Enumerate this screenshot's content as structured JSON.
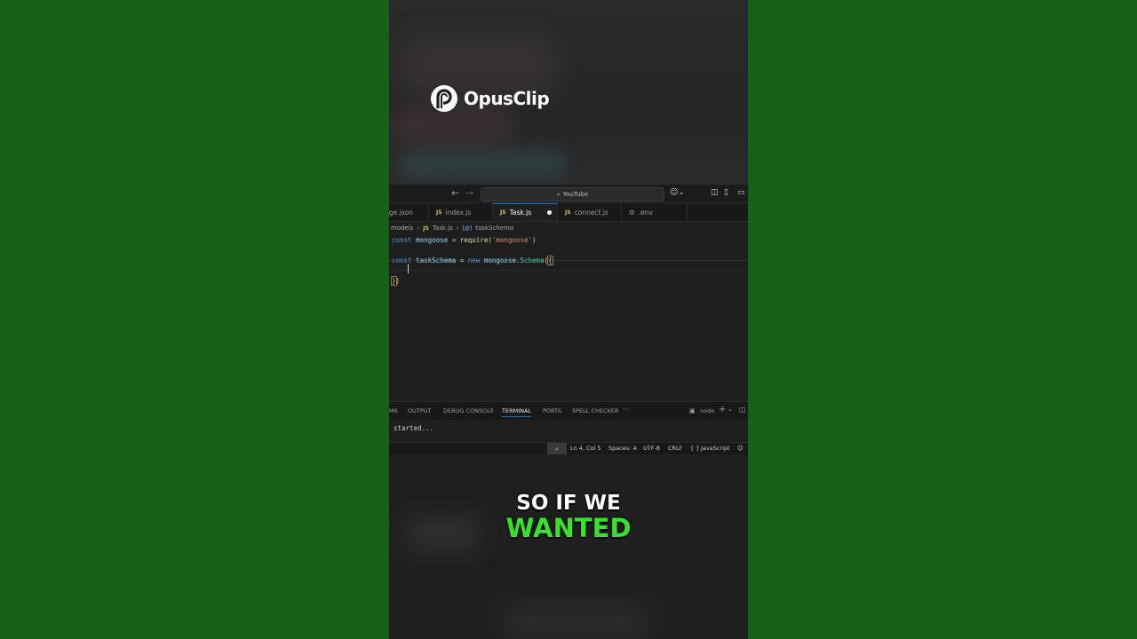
{
  "brand": {
    "name": "OpusClip"
  },
  "titlebar": {
    "search_text": "YouTube"
  },
  "tabs": [
    {
      "label": "ge.json",
      "icon": "json-icon"
    },
    {
      "label": "index.js",
      "icon": "JS"
    },
    {
      "label": "Task.js",
      "icon": "JS",
      "active": true,
      "modified": true
    },
    {
      "label": "connect.js",
      "icon": "JS"
    },
    {
      "label": ".env",
      "icon": "gear-icon"
    }
  ],
  "breadcrumb": {
    "folder": "models",
    "file_icon": "JS",
    "file": "Task.js",
    "symbol_icon": "[@]",
    "symbol": "taskSchema"
  },
  "code": {
    "line1": {
      "kw": "const",
      "var": "mongoose",
      "op": " = ",
      "fn": "require",
      "open": "(",
      "str": "'mongoose'",
      "close": ")"
    },
    "line3": {
      "kw": "const",
      "var": "taskSchema",
      "op": " = ",
      "kw2": "new",
      "obj": "mongoose",
      "dot": ".",
      "cls": "Schema",
      "open": "(",
      "brace": "{"
    },
    "line5": {
      "brace": "}",
      "close": ")"
    }
  },
  "panel": {
    "tabs": [
      "MS",
      "OUTPUT",
      "DEBUG CONSOLE",
      "TERMINAL",
      "PORTS",
      "SPELL CHECKER"
    ],
    "more": "···",
    "terminal_name": "node",
    "terminal_output": "started..."
  },
  "status": {
    "position": "Ln 4, Col 5",
    "spaces": "Spaces: 4",
    "encoding": "UTF-8",
    "eol": "CRLF",
    "language_icon": "{ }",
    "language": "JavaScript"
  },
  "caption": {
    "line1": "SO IF WE",
    "line2": "WANTED"
  },
  "colors": {
    "background": "#166118",
    "caption_highlight": "#39e22a",
    "accent": "#0078d4"
  }
}
